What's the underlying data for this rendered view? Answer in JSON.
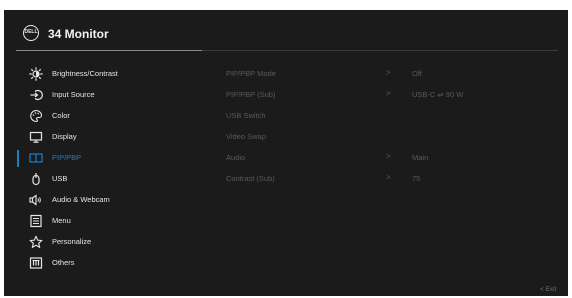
{
  "header": {
    "logo_text": "DELL",
    "title": "34 Monitor"
  },
  "menu": {
    "items": [
      {
        "label": "Brightness/Contrast",
        "icon": "brightness-icon"
      },
      {
        "label": "Input Source",
        "icon": "input-source-icon"
      },
      {
        "label": "Color",
        "icon": "color-palette-icon"
      },
      {
        "label": "Display",
        "icon": "display-icon"
      },
      {
        "label": "PIP/PBP",
        "icon": "pip-pbp-icon"
      },
      {
        "label": "USB",
        "icon": "usb-icon"
      },
      {
        "label": "Audio & Webcam",
        "icon": "audio-webcam-icon"
      },
      {
        "label": "Menu",
        "icon": "menu-icon"
      },
      {
        "label": "Personalize",
        "icon": "star-icon"
      },
      {
        "label": "Others",
        "icon": "others-icon"
      }
    ],
    "active_index": 4
  },
  "submenu": {
    "items": [
      {
        "label": "PIP/PBP Mode",
        "arrow": ">",
        "value": "Off"
      },
      {
        "label": "PIP/PBP (Sub)",
        "arrow": ">",
        "value": "USB-C ⇌ 90 W"
      },
      {
        "label": "USB Switch",
        "arrow": "",
        "value": ""
      },
      {
        "label": "Video Swap",
        "arrow": "",
        "value": ""
      },
      {
        "label": "Audio",
        "arrow": ">",
        "value": "Main"
      },
      {
        "label": "Contrast (Sub)",
        "arrow": ">",
        "value": "75"
      }
    ]
  },
  "footer": {
    "exit_label": "< Exit"
  },
  "colors": {
    "background": "#1b1b1b",
    "accent": "#1e7fc9",
    "text": "#e6e6e6",
    "disabled_text": "#5a5a5a"
  }
}
